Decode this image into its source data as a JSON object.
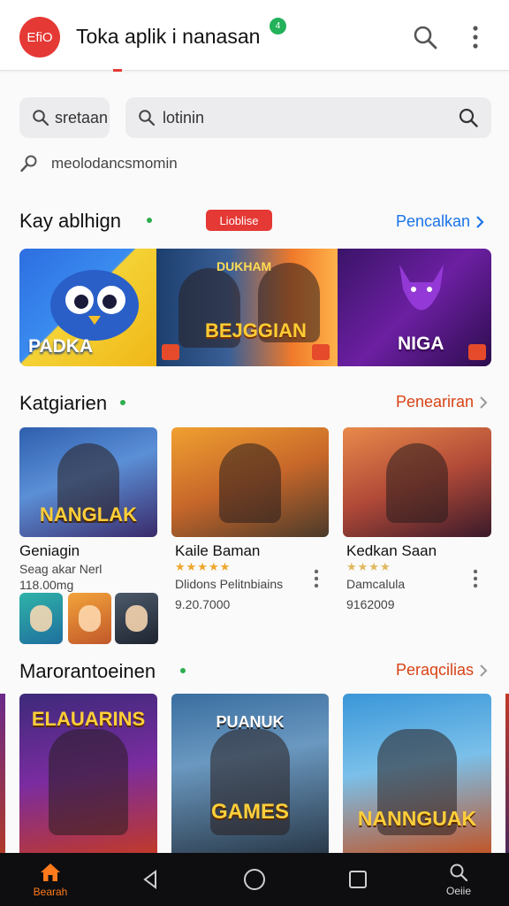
{
  "app": {
    "logo_text": "EfiO",
    "title": "Toka aplik i nanasan",
    "notification_count": "4"
  },
  "search": {
    "chip_label": "sretaan",
    "main_placeholder": "lotinin",
    "history_text": "meolodancsmomin"
  },
  "section_featured": {
    "title": "Kay ablhign",
    "badge": "Lioblise",
    "link": "Pencalkan",
    "banners": [
      {
        "label": "PADKA"
      },
      {
        "top_label": "DUKHAM",
        "label": "BEJGGIAN"
      },
      {
        "label": "NIGA"
      }
    ]
  },
  "section_categories": {
    "title": "Katgiarien",
    "link": "Peneariran",
    "cards": [
      {
        "image_caption": "NANGLAK",
        "name": "Geniagin",
        "line1": "Seag akar Nerl",
        "line2": "118.00mg"
      },
      {
        "image_caption": "",
        "name": "Kaile Baman",
        "rating_text": "★★★★★",
        "line1": "Dlidons Pelitnbiains",
        "line2": "9.20.7000"
      },
      {
        "image_caption": "",
        "name": "Kedkan Saan",
        "rating_text": "★★★★",
        "line1": "Damcalula",
        "line2": "9162009"
      }
    ]
  },
  "section_recommended": {
    "title": "Marorantoeinen",
    "link": "Peraqcilias",
    "cards": [
      {
        "caption": "ELAUARINS"
      },
      {
        "caption_top": "PUANUK",
        "caption": "GAMES"
      },
      {
        "caption": "NANNGUAK"
      }
    ]
  },
  "nav": {
    "home_label": "Bearah",
    "search_label": "Oeiie"
  },
  "colors": {
    "accent_red": "#e53935",
    "link_blue": "#1a73e8",
    "link_orange_red": "#d84315",
    "nav_active": "#ff7a1a",
    "star": "#f0a52a"
  }
}
